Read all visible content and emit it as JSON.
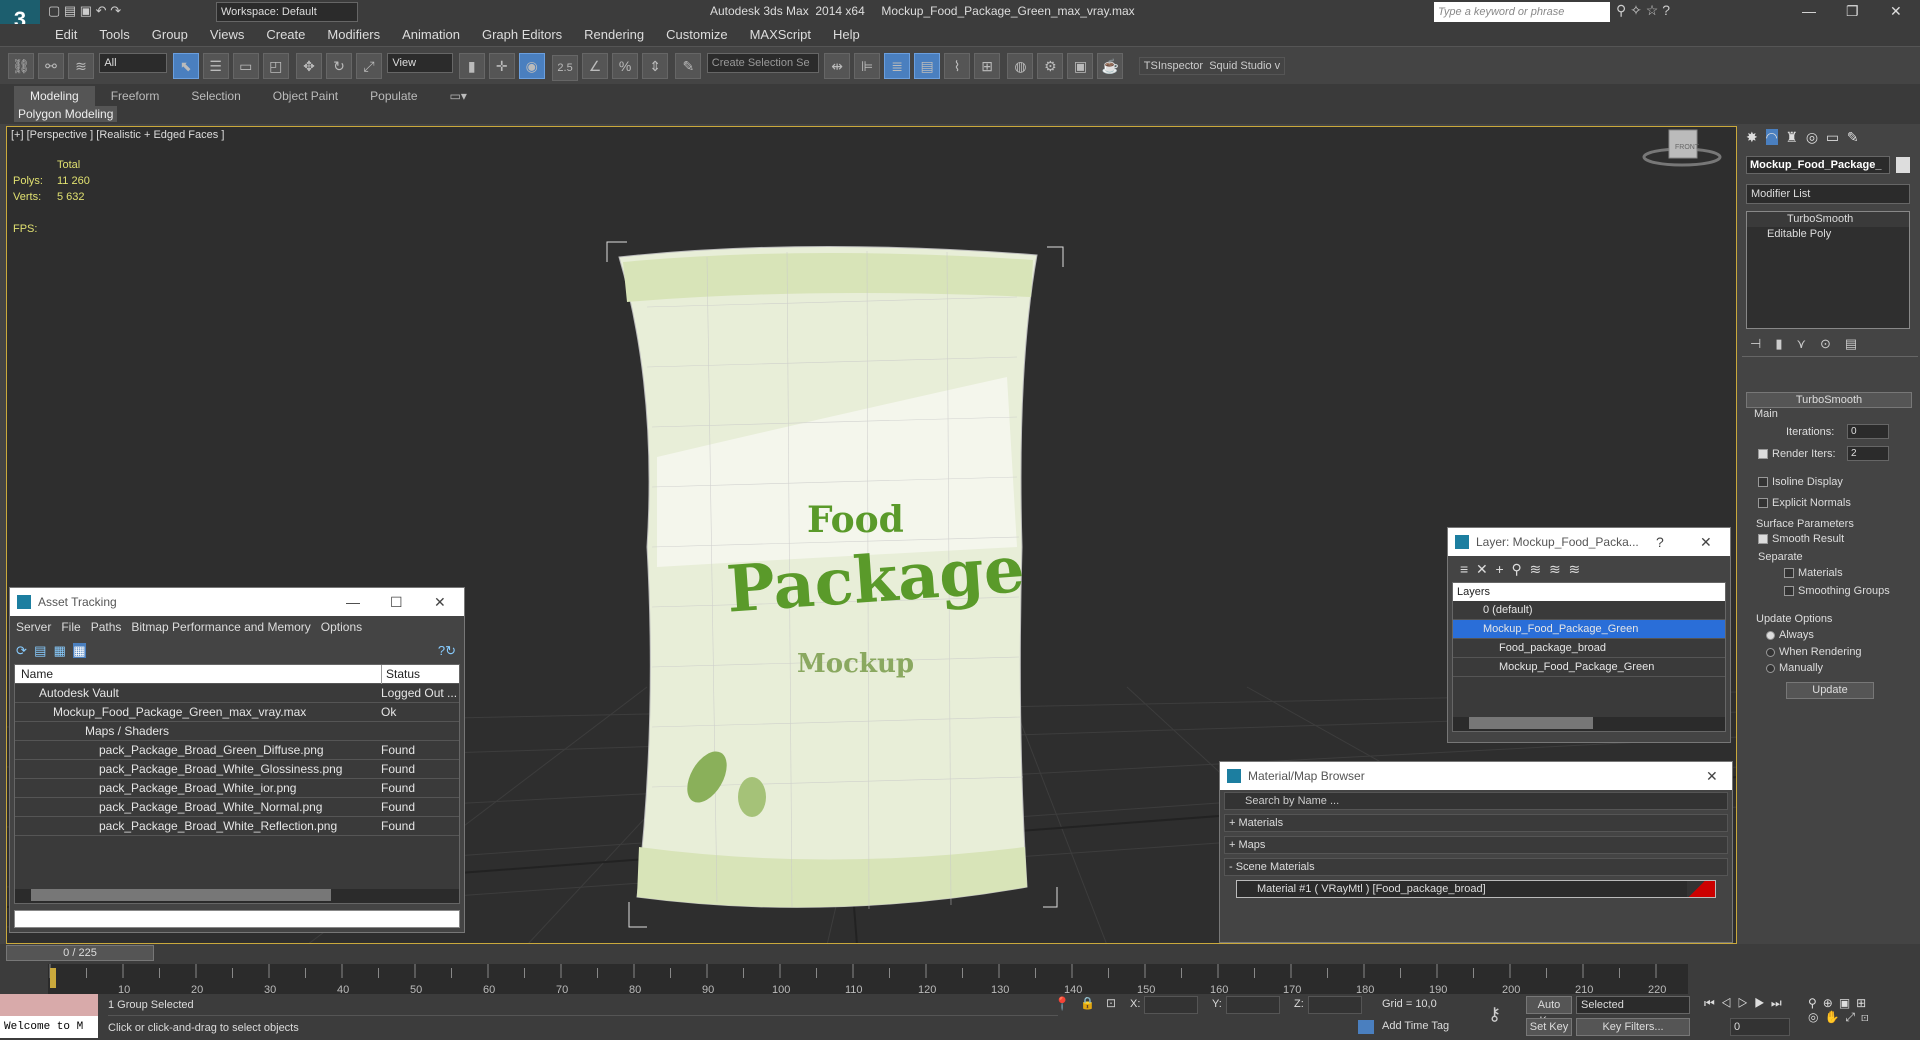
{
  "app": {
    "title": "Autodesk 3ds Max  2014 x64     Mockup_Food_Package_Green_max_vray.max",
    "workspace": "Workspace: Default",
    "search_placeholder": "Type a keyword or phrase"
  },
  "menu": [
    "Edit",
    "Tools",
    "Group",
    "Views",
    "Create",
    "Modifiers",
    "Animation",
    "Graph Editors",
    "Rendering",
    "Customize",
    "MAXScript",
    "Help"
  ],
  "toolbar": {
    "filter": "All",
    "ref_coord": "View",
    "snap_label": "2.5",
    "selection_set_placeholder": "Create Selection Se",
    "plugins": "TSInspector  Squid Studio v"
  },
  "ribbon": {
    "tabs": [
      "Modeling",
      "Freeform",
      "Selection",
      "Object Paint",
      "Populate"
    ],
    "subpanel": "Polygon Modeling"
  },
  "viewport": {
    "label": "[+] [Perspective ] [Realistic + Edged Faces ]",
    "stats_header": "Total",
    "polys_label": "Polys:",
    "polys_value": "11 260",
    "verts_label": "Verts:",
    "verts_value": "5 632",
    "fps_label": "FPS:",
    "product_text1": "Food",
    "product_text2": "Package",
    "product_text3": "Mockup",
    "viewcube_label": "FRONT"
  },
  "asset_tracking": {
    "title": "Asset Tracking",
    "menu": [
      "Server",
      "File",
      "Paths",
      "Bitmap Performance and Memory",
      "Options"
    ],
    "col_name": "Name",
    "col_status": "Status",
    "rows": [
      {
        "name": "Autodesk Vault",
        "status": "Logged Out ..."
      },
      {
        "name": "Mockup_Food_Package_Green_max_vray.max",
        "status": "Ok"
      },
      {
        "name": "Maps / Shaders",
        "status": ""
      },
      {
        "name": "pack_Package_Broad_Green_Diffuse.png",
        "status": "Found"
      },
      {
        "name": "pack_Package_Broad_White_Glossiness.png",
        "status": "Found"
      },
      {
        "name": "pack_Package_Broad_White_ior.png",
        "status": "Found"
      },
      {
        "name": "pack_Package_Broad_White_Normal.png",
        "status": "Found"
      },
      {
        "name": "pack_Package_Broad_White_Reflection.png",
        "status": "Found"
      }
    ]
  },
  "layer_dialog": {
    "title": "Layer: Mockup_Food_Packa...",
    "help": "?",
    "header": "Layers",
    "items": [
      "0 (default)",
      "Mockup_Food_Package_Green",
      "Food_package_broad",
      "Mockup_Food_Package_Green"
    ]
  },
  "material_browser": {
    "title": "Material/Map Browser",
    "search_placeholder": "Search by Name ...",
    "groups": [
      "+ Materials",
      "+ Maps",
      "- Scene Materials"
    ],
    "material": "Material #1  ( VRayMtl )  [Food_package_broad]"
  },
  "command_panel": {
    "object_name": "Mockup_Food_Package_",
    "modifier_list": "Modifier List",
    "stack": [
      "TurboSmooth",
      "Editable Poly"
    ],
    "rollout_title": "TurboSmooth",
    "main_label": "Main",
    "iterations_label": "Iterations:",
    "iterations_value": "0",
    "render_iters_label": "Render Iters:",
    "render_iters_value": "2",
    "isoline": "Isoline Display",
    "explicit": "Explicit Normals",
    "surface_params": "Surface Parameters",
    "smooth_result": "Smooth Result",
    "separate": "Separate",
    "materials": "Materials",
    "smoothing_groups": "Smoothing Groups",
    "update_options": "Update Options",
    "always": "Always",
    "when_rendering": "When Rendering",
    "manually": "Manually",
    "update_btn": "Update"
  },
  "timeline": {
    "frame": "0 / 225",
    "ticks": [
      "10",
      "20",
      "30",
      "40",
      "50",
      "60",
      "70",
      "80",
      "90",
      "100",
      "110",
      "120",
      "130",
      "140",
      "150",
      "160",
      "170",
      "180",
      "190",
      "200",
      "210",
      "220"
    ],
    "status_selected": "1 Group Selected",
    "prompt": "Click or click-and-drag to select objects",
    "welcome": "Welcome to M",
    "x_label": "X:",
    "y_label": "Y:",
    "z_label": "Z:",
    "grid": "Grid = 10,0",
    "add_time_tag": "Add Time Tag",
    "auto_key": "Auto Key",
    "set_key": "Set Key",
    "selected_dd": "Selected",
    "key_filters": "Key Filters...",
    "frame_field": "0"
  }
}
